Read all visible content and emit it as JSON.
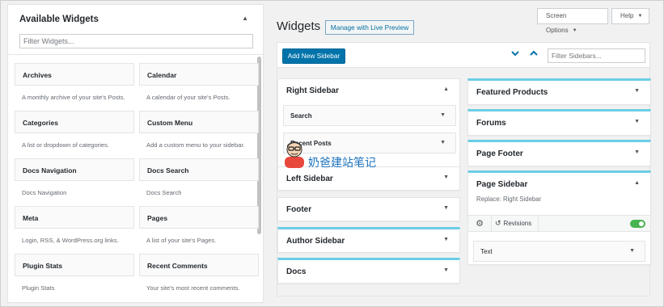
{
  "available_widgets": {
    "title": "Available Widgets",
    "filter_placeholder": "Filter Widgets...",
    "widgets": [
      {
        "name": "Archives",
        "description": "A monthly archive of your site's Posts."
      },
      {
        "name": "Calendar",
        "description": "A calendar of your site's Posts."
      },
      {
        "name": "Categories",
        "description": "A list or dropdown of categories."
      },
      {
        "name": "Custom Menu",
        "description": "Add a custom menu to your sidebar."
      },
      {
        "name": "Docs Navigation",
        "description": "Docs Navigation"
      },
      {
        "name": "Docs Search",
        "description": "Docs Search"
      },
      {
        "name": "Meta",
        "description": "Login, RSS, & WordPress.org links."
      },
      {
        "name": "Pages",
        "description": "A list of your site's Pages."
      },
      {
        "name": "Plugin Stats",
        "description": "Plugin Stats"
      },
      {
        "name": "Recent Comments",
        "description": "Your site's most recent comments."
      }
    ]
  },
  "header": {
    "title": "Widgets",
    "live_preview": "Manage with Live Preview",
    "screen_options": "Screen Options",
    "help": "Help"
  },
  "toolbar": {
    "add_sidebar": "Add New Sidebar",
    "filter_placeholder": "Filter Sidebars..."
  },
  "sidebars_left": {
    "right_sidebar": {
      "title": "Right Sidebar",
      "widgets": [
        "Search",
        "Recent Posts"
      ]
    },
    "left_sidebar": "Left Sidebar",
    "footer": "Footer",
    "author_sidebar": "Author Sidebar",
    "docs": "Docs"
  },
  "sidebars_right": {
    "featured_products": "Featured Products",
    "forums": "Forums",
    "page_footer": "Page Footer",
    "page_sidebar": {
      "title": "Page Sidebar",
      "subtitle": "Replace: Right Sidebar",
      "revisions_label": "Revisions",
      "widgets": [
        "Text"
      ]
    }
  },
  "watermark": {
    "text": "奶爸建站笔记"
  },
  "colors": {
    "accent": "#6bcde6",
    "primary": "#0073aa",
    "toggle_on": "#46b450"
  }
}
